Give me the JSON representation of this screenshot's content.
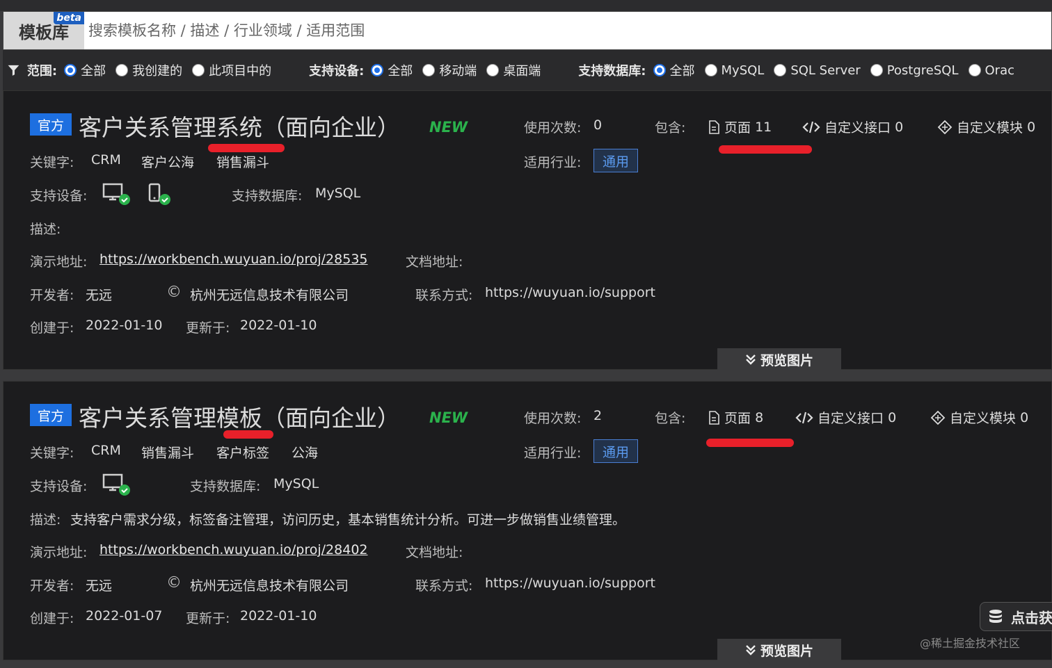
{
  "header": {
    "library_tab": "模板库",
    "beta": "beta",
    "search_placeholder": "搜索模板名称 / 描述 / 行业领域 / 适用范围"
  },
  "filters": {
    "scope": {
      "label": "范围:",
      "options": [
        "全部",
        "我创建的",
        "此项目中的"
      ],
      "selected": "全部"
    },
    "device": {
      "label": "支持设备:",
      "options": [
        "全部",
        "移动端",
        "桌面端"
      ],
      "selected": "全部"
    },
    "database": {
      "label": "支持数据库:",
      "options": [
        "全部",
        "MySQL",
        "SQL Server",
        "PostgreSQL",
        "Orac"
      ],
      "selected": "全部"
    }
  },
  "labels": {
    "official": "官方",
    "new": "NEW",
    "usage": "使用次数:",
    "contains": "包含:",
    "industry": "适用行业:",
    "keywords": "关键字:",
    "devices": "支持设备:",
    "database": "支持数据库:",
    "description": "描述:",
    "demo": "演示地址:",
    "docs": "文档地址:",
    "developer": "开发者:",
    "contact": "联系方式:",
    "created": "创建于:",
    "updated": "更新于:",
    "preview": "预览图片",
    "pages": "页面",
    "custom_api": "自定义接口",
    "custom_module": "自定义模块",
    "copyright": "©"
  },
  "templates": [
    {
      "title": "客户关系管理系统（面向企业）",
      "usage_count": "0",
      "pages": "11",
      "custom_api": "0",
      "custom_module": "0",
      "industry": "通用",
      "keywords": [
        "CRM",
        "客户公海",
        "销售漏斗"
      ],
      "devices": [
        "desktop",
        "mobile"
      ],
      "database": "MySQL",
      "description": "",
      "demo_url": "https://workbench.wuyuan.io/proj/28535",
      "docs_url": "",
      "developer": "无远",
      "company": "杭州无远信息技术有限公司",
      "contact": "https://wuyuan.io/support",
      "created": "2022-01-10",
      "updated": "2022-01-10"
    },
    {
      "title": "客户关系管理模板（面向企业）",
      "usage_count": "2",
      "pages": "8",
      "custom_api": "0",
      "custom_module": "0",
      "industry": "通用",
      "keywords": [
        "CRM",
        "销售漏斗",
        "客户标签",
        "公海"
      ],
      "devices": [
        "desktop"
      ],
      "database": "MySQL",
      "description": "支持客户需求分级，标签备注管理，访问历史，基本销售统计分析。可进一步做销售业绩管理。",
      "demo_url": "https://workbench.wuyuan.io/proj/28402",
      "docs_url": "",
      "developer": "无远",
      "company": "杭州无远信息技术有限公司",
      "contact": "https://wuyuan.io/support",
      "created": "2022-01-07",
      "updated": "2022-01-10"
    }
  ],
  "fab": {
    "label": "点击获"
  },
  "watermark": "@稀土掘金技术社区",
  "colors": {
    "accent": "#1e6fe8",
    "new": "#2bb24c",
    "annotation_red": "#e8202a",
    "card_bg": "#1c1c1e"
  }
}
